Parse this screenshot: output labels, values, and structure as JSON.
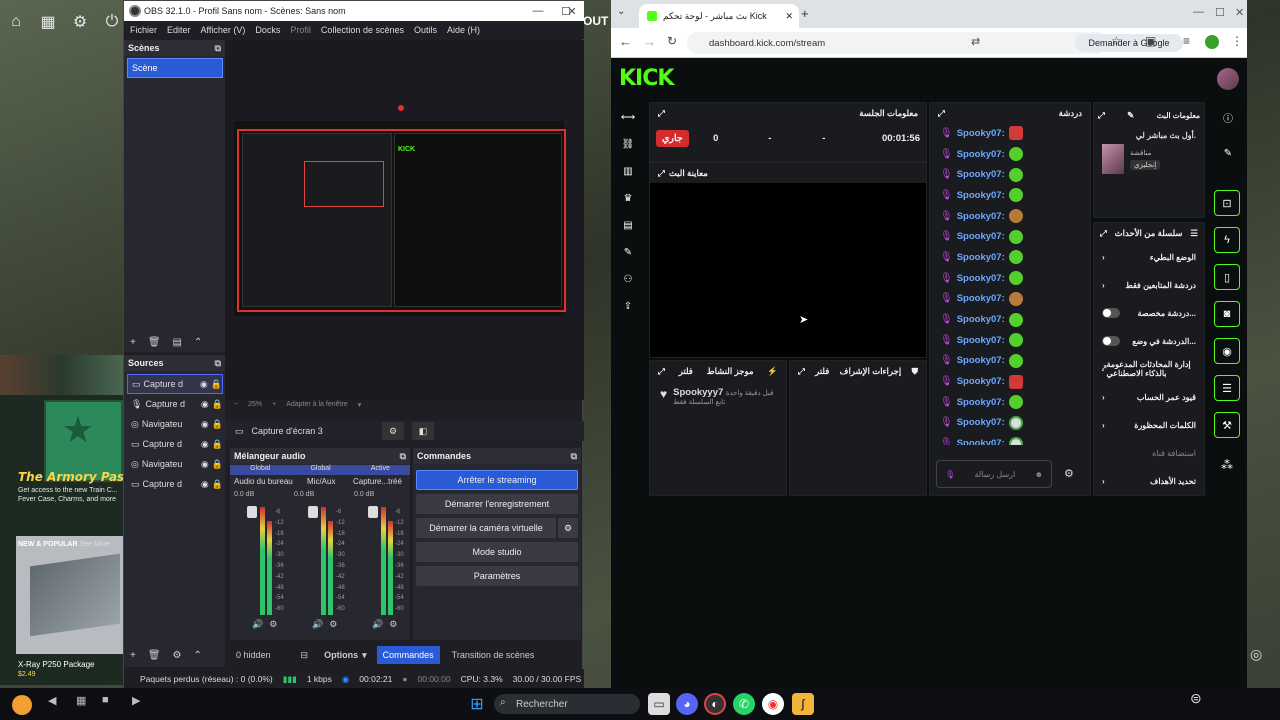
{
  "obs": {
    "title": "OBS 32.1.0 - Profil Sans nom - Scènes: Sans nom",
    "menu": [
      "Fichier",
      "Editer",
      "Afficher (V)",
      "Docks",
      "Profil",
      "Collection de scènes",
      "Outils",
      "Aide (H)"
    ],
    "scenes_header": "Scènes",
    "scene_selected": "Scène",
    "sources_header": "Sources",
    "sources": [
      "Capture d",
      "Capture d",
      "Navigateu",
      "Capture d",
      "Navigateu",
      "Capture d"
    ],
    "zoom": "25%",
    "fit_label": "Adapter à la fenêtre",
    "source_toolbar_name": "Capture d'écran 3",
    "mixer_header": "Mélangeur audio",
    "commands_header": "Commandes",
    "mixer_channels": [
      {
        "name": "Audio du bureau",
        "tag": "Global",
        "db": "0.0 dB"
      },
      {
        "name": "Mic/Aux",
        "tag": "Global",
        "db": "0.0 dB"
      },
      {
        "name": "Capture...tréé",
        "tag": "Active",
        "db": "0.0 dB"
      }
    ],
    "meter_ticks": [
      "-6",
      "-12",
      "-18",
      "-24",
      "-30",
      "-36",
      "-42",
      "-48",
      "-54",
      "-60"
    ],
    "commands": {
      "stop_streaming": "Arrêter le streaming",
      "start_recording": "Démarrer l'enregistrement",
      "start_virtual_cam": "Démarrer la caméra virtuelle",
      "studio_mode": "Mode studio",
      "settings": "Paramètres"
    },
    "bottom": {
      "hidden": "0 hidden",
      "options": "Options",
      "tab_commands": "Commandes",
      "tab_transitions": "Transition de scènes"
    },
    "status": {
      "dropped": "Paquets perdus (réseau) : 0 (0.0%)",
      "kbps": "1 kbps",
      "stream_time": "00:02:21",
      "rec_time": "00:00:00",
      "cpu": "CPU: 3.3%",
      "fps": "30.00 / 30.00 FPS"
    }
  },
  "desktop": {
    "outtxt": "OUT"
  },
  "ad": {
    "title": "The Armory Pass",
    "desc": "Get access to the new Train C... Fever Case, Charms, and more",
    "new_popular": "NEW & POPULAR",
    "see_more": "See More",
    "product": "X-Ray P250 Package",
    "price": "$2.49"
  },
  "chrome": {
    "tab_title": "بث مباشر - لوحة تحكم Kick",
    "url": "dashboard.kick.com/stream",
    "google_btn": "Demander à Google"
  },
  "kick": {
    "logo": "KICK",
    "session_title": "معلومات الجلسة",
    "live_badge": "جاري",
    "stats": [
      "0",
      "-",
      "-",
      "00:01:56"
    ],
    "preview_title": "معاينة البث",
    "chat_title": "دردشة",
    "chat_user": "Spooky07:",
    "chat_count": 16,
    "chat_placeholder": "ارسل رسالة",
    "activity_title": "موجز النشاط",
    "filter": "فلتر",
    "mod_title": "إجراءات الإشراف",
    "activity_user": "Spookyyy7",
    "activity_time": "قبل دقيقة واحدة",
    "activity_desc": "تابع السلسلة فقط",
    "stream_info_title": "معلومات البث",
    "stream_name": "أول بث مباشر لي.",
    "stream_category": "مناقشة",
    "stream_lang": "إنجليزي",
    "events_title": "سلسلة من الأحداث",
    "nav": [
      {
        "label": "الوضع البطيء",
        "type": "arrow"
      },
      {
        "label": "دردشة المتابعين فقط",
        "type": "arrow"
      },
      {
        "label": "دردشة مخصصة...",
        "type": "toggle"
      },
      {
        "label": "الدردشة في وضع...",
        "type": "toggle"
      },
      {
        "label": "إدارة المحادثات المدعومة بالذكاء الاصطناعي",
        "type": "ext"
      },
      {
        "label": "قيود عمر الحساب",
        "type": "arrow"
      },
      {
        "label": "الكلمات المحظورة",
        "type": "arrow"
      },
      {
        "label": "استضافة قناة",
        "type": "none"
      },
      {
        "label": "تحديد الأهداف",
        "type": "arrow"
      }
    ]
  },
  "taskbar": {
    "search": "Rechercher"
  }
}
